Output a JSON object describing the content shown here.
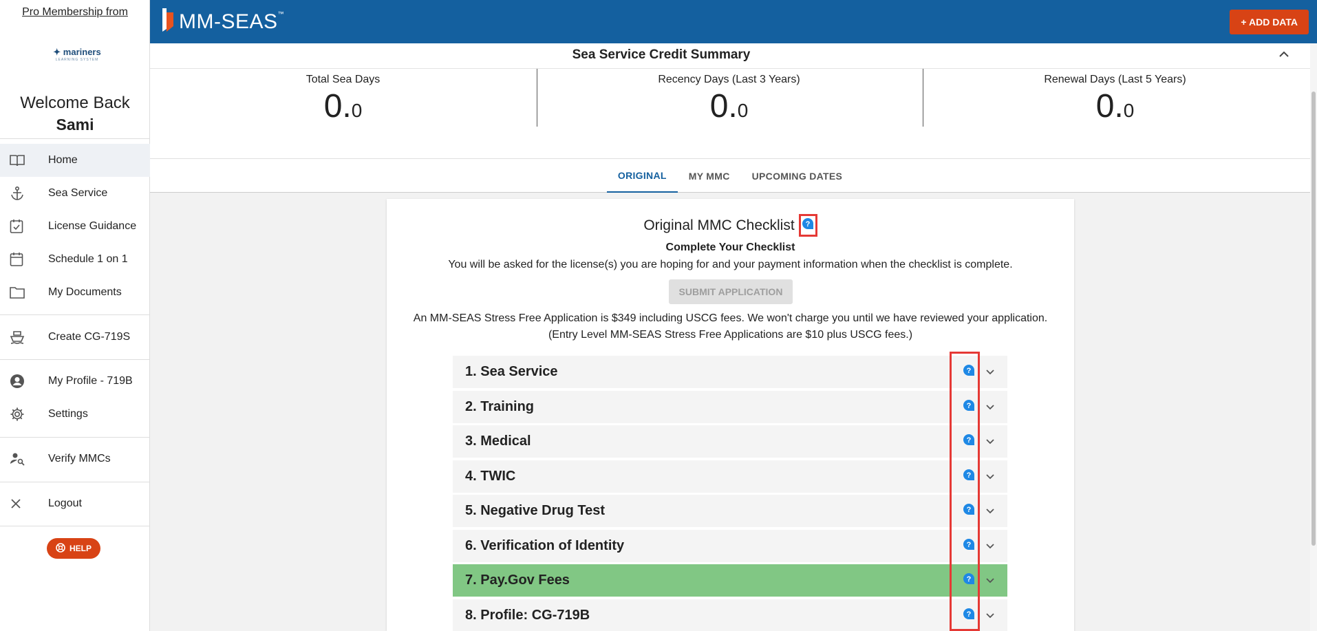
{
  "sidebar": {
    "pro_link": "Pro Membership from",
    "logo_word": "mariners",
    "logo_sub": "LEARNING SYSTEM",
    "welcome": "Welcome Back",
    "username": "Sami",
    "items": [
      {
        "label": "Home",
        "icon": "book-icon",
        "active": true
      },
      {
        "label": "Sea Service",
        "icon": "anchor-icon"
      },
      {
        "label": "License Guidance",
        "icon": "calendar-check-icon"
      },
      {
        "label": "Schedule 1 on 1",
        "icon": "calendar-icon"
      },
      {
        "label": "My Documents",
        "icon": "folder-icon"
      },
      {
        "label": "Create CG-719S",
        "icon": "ship-icon"
      },
      {
        "label": "My Profile - 719B",
        "icon": "account-circle-icon"
      },
      {
        "label": "Settings",
        "icon": "gear-icon"
      },
      {
        "label": "Verify MMCs",
        "icon": "person-search-icon"
      },
      {
        "label": "Logout",
        "icon": "close-icon"
      }
    ],
    "help_label": "HELP"
  },
  "topbar": {
    "brand": "MM-SEAS",
    "brand_tm": "™",
    "add_data": "+ ADD DATA",
    "color": "#14609f"
  },
  "summary": {
    "title": "Sea Service Credit Summary",
    "stats": [
      {
        "label": "Total Sea Days",
        "whole": "0.",
        "frac": "0"
      },
      {
        "label": "Recency Days (Last 3 Years)",
        "whole": "0.",
        "frac": "0"
      },
      {
        "label": "Renewal Days (Last 5 Years)",
        "whole": "0.",
        "frac": "0"
      }
    ]
  },
  "tabs": [
    {
      "label": "ORIGINAL",
      "active": true
    },
    {
      "label": "MY MMC"
    },
    {
      "label": "UPCOMING DATES"
    }
  ],
  "main": {
    "title": "Original MMC Checklist",
    "subtitle": "Complete Your Checklist",
    "subtext": "You will be asked for the license(s) you are hoping for and your payment information when the checklist is complete.",
    "submit_label": "SUBMIT APPLICATION",
    "fee_line1": "An MM-SEAS Stress Free Application is $349 including USCG fees. We won't charge you until we have reviewed your application.",
    "fee_line2": "(Entry Level MM-SEAS Stress Free Applications are $10 plus USCG fees.)",
    "checklist": [
      {
        "label": "1. Sea Service"
      },
      {
        "label": "2. Training"
      },
      {
        "label": "3. Medical"
      },
      {
        "label": "4. TWIC"
      },
      {
        "label": "5. Negative Drug Test"
      },
      {
        "label": "6. Verification of Identity"
      },
      {
        "label": "7. Pay.Gov Fees",
        "complete": true
      },
      {
        "label": "8. Profile: CG-719B"
      }
    ],
    "complete_color": "#81c784"
  }
}
